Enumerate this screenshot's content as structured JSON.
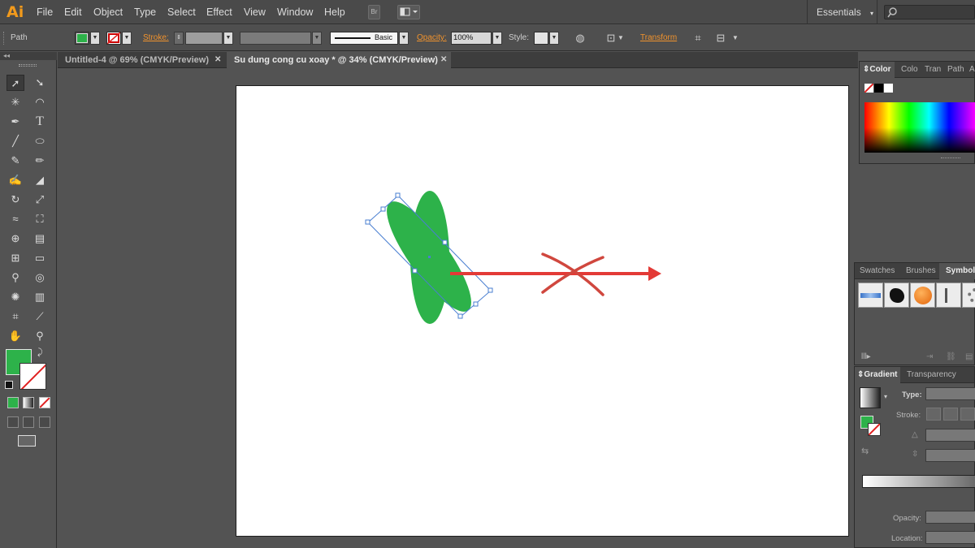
{
  "app": {
    "logo": "Ai"
  },
  "menu": [
    "File",
    "Edit",
    "Object",
    "Type",
    "Select",
    "Effect",
    "View",
    "Window",
    "Help"
  ],
  "menubar": {
    "bridge_label": "Br",
    "workspace": "Essentials"
  },
  "control_bar": {
    "selection_label": "Path",
    "fill_color": "#2db24a",
    "stroke_label": "Stroke:",
    "brush_label": "Basic",
    "opacity_label": "Opacity:",
    "opacity_value": "100%",
    "style_label": "Style:",
    "transform_label": "Transform"
  },
  "tabs": [
    {
      "title": "Untitled-4 @ 69% (CMYK/Preview)",
      "active": false
    },
    {
      "title": "Su dung cong cu xoay * @ 34% (CMYK/Preview)",
      "active": true
    }
  ],
  "tools": {
    "fill_color": "#2db24a",
    "text_tool_glyph": "T"
  },
  "color_panel": {
    "tabs": [
      "Color",
      "Colo",
      "Tran",
      "Path",
      "A"
    ],
    "active": "Color"
  },
  "symbols_panel": {
    "tabs": [
      "Swatches",
      "Brushes",
      "Symbols"
    ],
    "active": "Symbols"
  },
  "gradient_panel": {
    "tabs": [
      "Gradient",
      "Transparency"
    ],
    "active": "Gradient",
    "type_label": "Type:",
    "stroke_label": "Stroke:",
    "opacity_label": "Opacity:",
    "location_label": "Location:"
  },
  "artwork": {
    "ellipse_color": "#2db24a",
    "arrow_color": "#e33a36",
    "cross_color": "#d0473e",
    "selection_color": "#4a7fd1"
  }
}
